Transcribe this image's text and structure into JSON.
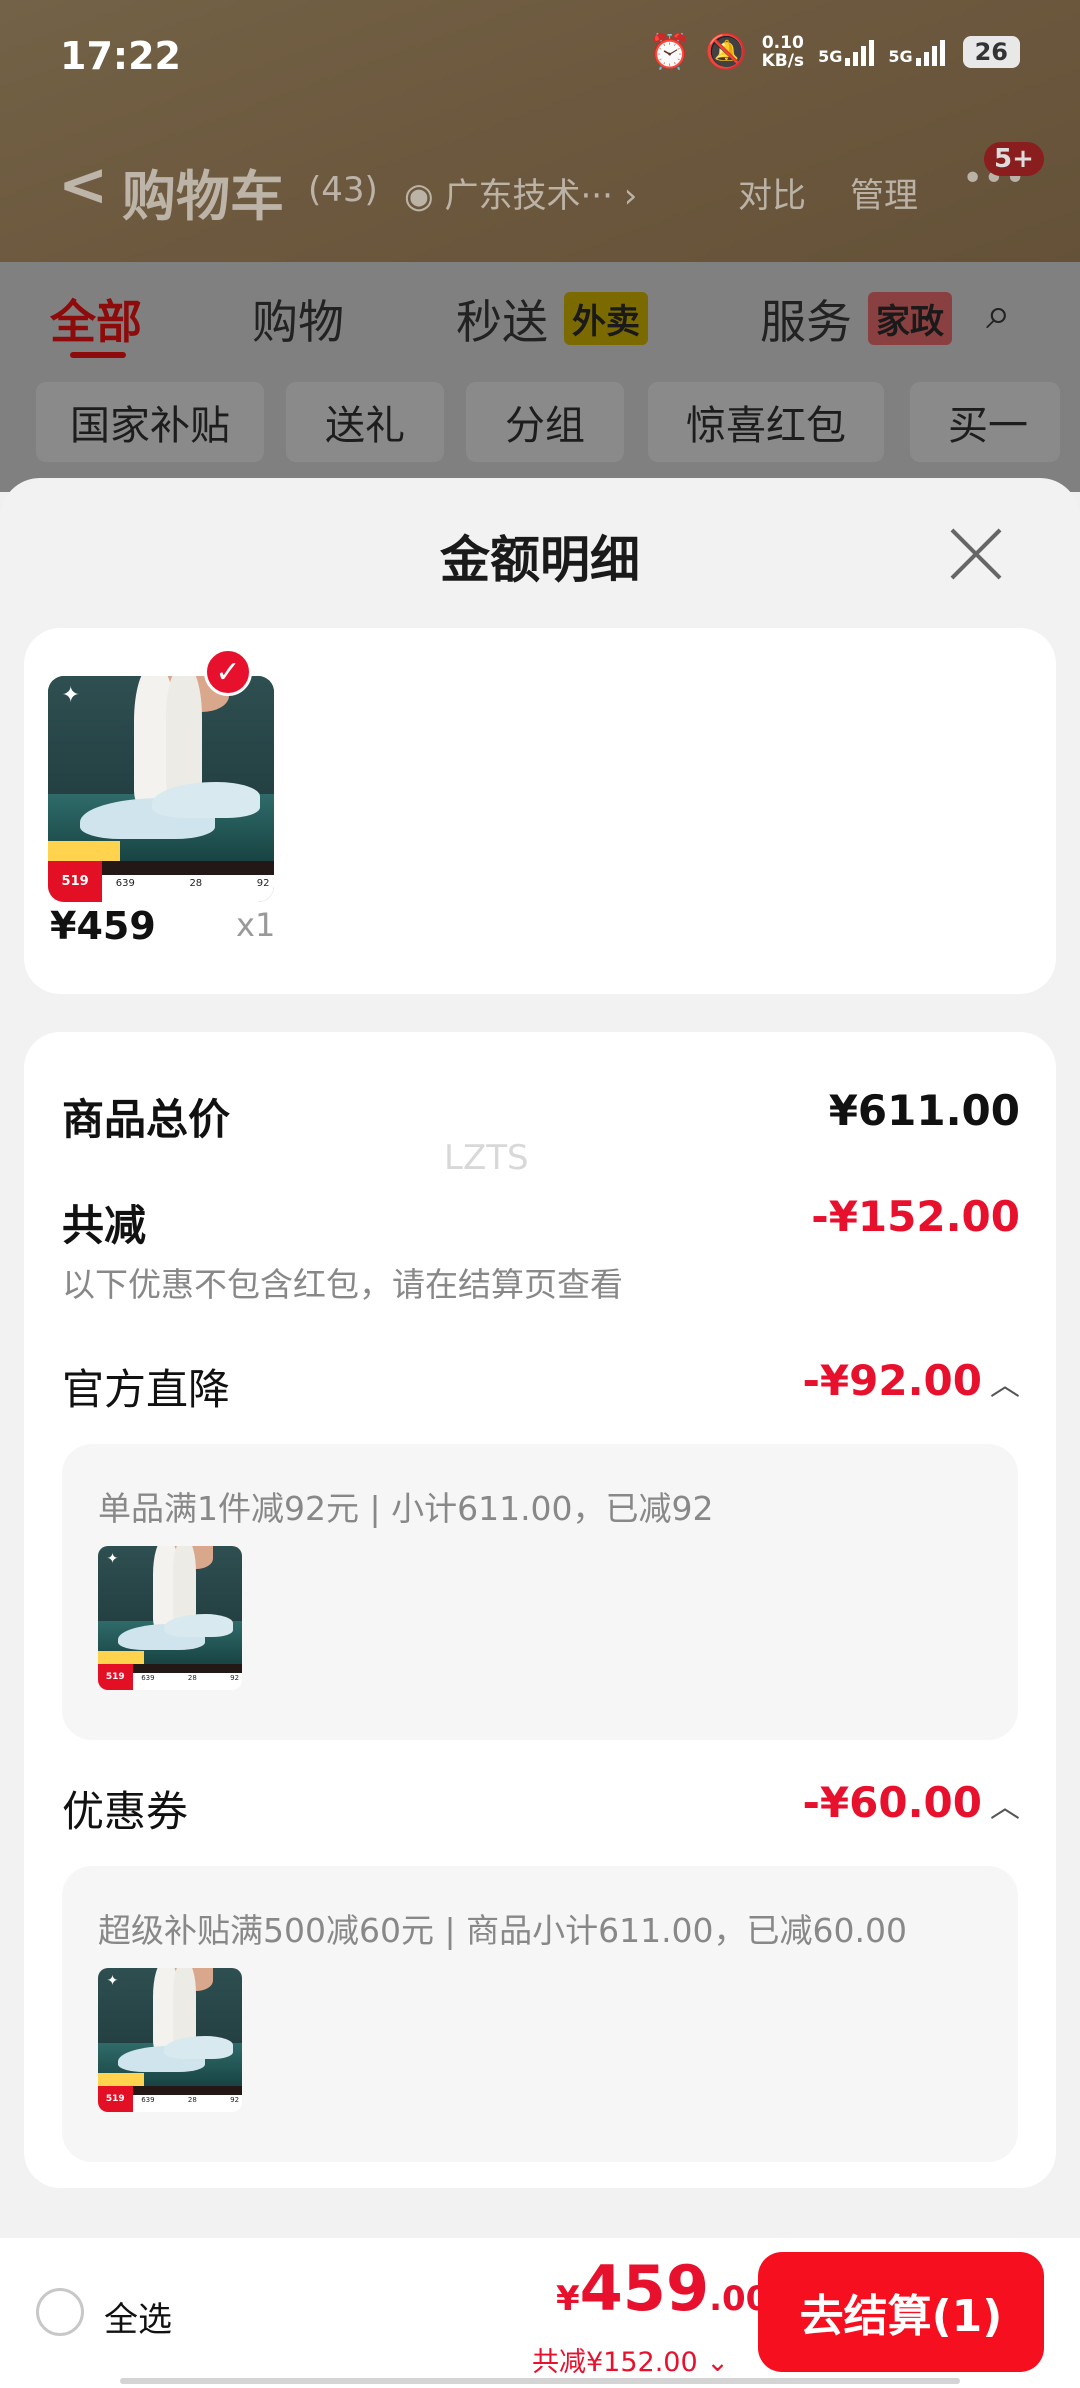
{
  "status_bar": {
    "time": "17:22",
    "net_speed_value": "0.10",
    "net_speed_unit": "KB/s",
    "sig1_label": "5G",
    "sig2_label": "5G",
    "battery": "26"
  },
  "header": {
    "back_glyph": "<",
    "title": "购物车",
    "count": "(43)",
    "location": "广东技术···",
    "location_arrow": "›",
    "compare": "对比",
    "manage": "管理",
    "more_glyph": "•••",
    "notif_badge": "5+"
  },
  "tabs": [
    {
      "label": "全部",
      "active": true
    },
    {
      "label": "购物",
      "active": false
    },
    {
      "label": "秒送",
      "tag": "外卖",
      "active": false
    },
    {
      "label": "服务",
      "tag": "家政",
      "active": false
    }
  ],
  "chips": [
    "国家补贴",
    "送礼",
    "分组",
    "惊喜红包",
    "买一"
  ],
  "sheet": {
    "title": "金额明细",
    "product": {
      "price": "¥459",
      "qty": "x1",
      "thumb_price": "519",
      "thumb_nums": [
        "639",
        "28",
        "92"
      ]
    },
    "watermark": "LZTS",
    "rows": {
      "total_label": "商品总价",
      "total_value": "¥611.00",
      "discount_label": "共减",
      "discount_value": "-¥152.00",
      "discount_note": "以下优惠不包含红包，请在结算页查看",
      "official_label": "官方直降",
      "official_value": "-¥92.00",
      "official_detail": "单品满1件减92元 | 小计611.00，已减92",
      "coupon_label": "优惠券",
      "coupon_value": "-¥60.00",
      "coupon_detail": "超级补贴满500减60元 | 商品小计611.00，已减60.00"
    }
  },
  "bottom_bar": {
    "select_all": "全选",
    "currency": "¥",
    "total_int": "459",
    "total_dec": ".00",
    "saved": "共减¥152.00",
    "checkout": "去结算(1)"
  },
  "colors": {
    "accent_red": "#e8112d",
    "checkout_red": "#f50f1f"
  }
}
